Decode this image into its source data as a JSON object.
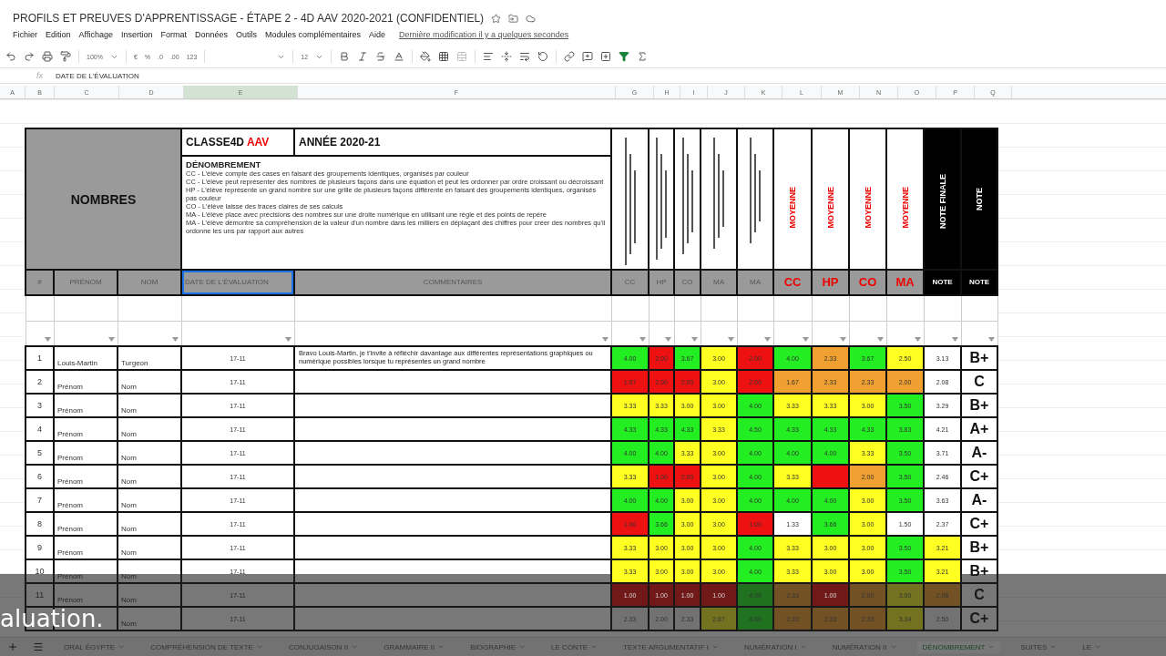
{
  "document": {
    "title": "PROFILS ET PREUVES D'APPRENTISSAGE - ÉTAPE 2 - 4D AAV 2020-2021 (CONFIDENTIEL)"
  },
  "menu": [
    "Fichier",
    "Edition",
    "Affichage",
    "Insertion",
    "Format",
    "Données",
    "Outils",
    "Modules complémentaires",
    "Aide"
  ],
  "last_edit": "Dernière modification il y a quelques secondes",
  "toolbar": {
    "zoom": "100%",
    "currency": "€",
    "percent": "%",
    "decimals_less": ".0",
    "decimals_more": ".00",
    "number_format": "123",
    "font_size": "12"
  },
  "formula_bar": {
    "function_label": "fx",
    "value": "DATE DE L'ÉVALUATION"
  },
  "columns": [
    {
      "label": "A",
      "selected": false
    },
    {
      "label": "B",
      "selected": false
    },
    {
      "label": "C",
      "selected": false
    },
    {
      "label": "D",
      "selected": false
    },
    {
      "label": "E",
      "selected": true
    },
    {
      "label": "F",
      "selected": false
    },
    {
      "label": "G",
      "selected": false
    },
    {
      "label": "H",
      "selected": false
    },
    {
      "label": "I",
      "selected": false
    },
    {
      "label": "J",
      "selected": false
    },
    {
      "label": "K",
      "selected": false
    },
    {
      "label": "L",
      "selected": false
    },
    {
      "label": "M",
      "selected": false
    },
    {
      "label": "N",
      "selected": false
    },
    {
      "label": "O",
      "selected": false
    },
    {
      "label": "P",
      "selected": false
    },
    {
      "label": "Q",
      "selected": false
    }
  ],
  "sheet": {
    "subject": "NOMBRES",
    "class_name": "CLASSE4D",
    "class_tag": "AAV",
    "year": "ANNÉE 2020-21",
    "description_title": "DÉNOMBREMENT",
    "description": [
      "CC - L'élève compte des cases en faisant des groupements identiques, organisés par couleur",
      "CC - L'élève peut représenter des nombres de plusieurs façons dans une équation et peut les ordonner par ordre croissant ou décroissant",
      "HP - L'élève représente un grand nombre sur une grille de plusieurs façons différente en faisant des groupements identiques, organisés pas couleur",
      "CO - L'élève laisse des traces claires de ses calculs",
      "MA - L'élève place avec précisions des nombres sur une droite numérique en utilisant une règle et des points de repère",
      "MA - L'élève démontre sa compréhension de la valeur d'un nombre dans les milliers en déplaçant des chiffres pour créer des nombres qu'il ordonne les uns par rapport aux autres"
    ],
    "criteria": [
      {
        "kind": "lines"
      },
      {
        "kind": "lines"
      },
      {
        "kind": "lines"
      },
      {
        "kind": "lines"
      },
      {
        "kind": "lines"
      }
    ],
    "averages": [
      "MOYENNE",
      "MOYENNE",
      "MOYENNE",
      "MOYENNE"
    ],
    "final_title": "NOTE FINALE",
    "note_title": "NOTE"
  },
  "headers": [
    {
      "label": "#",
      "kind": "plain",
      "selected": false
    },
    {
      "label": "PRÉNOM",
      "kind": "plain",
      "selected": false
    },
    {
      "label": "NOM",
      "kind": "plain",
      "selected": false
    },
    {
      "label": "DATE DE L'ÉVALUATION",
      "kind": "plain",
      "selected": true
    },
    {
      "label": "COMMENTAIRES",
      "kind": "plain",
      "selected": false
    },
    {
      "label": "CC",
      "kind": "plain",
      "selected": false
    },
    {
      "label": "HP",
      "kind": "plain",
      "selected": false
    },
    {
      "label": "CO",
      "kind": "plain",
      "selected": false
    },
    {
      "label": "MA",
      "kind": "plain",
      "selected": false
    },
    {
      "label": "MA",
      "kind": "plain",
      "selected": false
    },
    {
      "label": "CC",
      "kind": "average",
      "selected": false
    },
    {
      "label": "HP",
      "kind": "average",
      "selected": false
    },
    {
      "label": "CO",
      "kind": "average",
      "selected": false
    },
    {
      "label": "MA",
      "kind": "average",
      "selected": false
    },
    {
      "label": "NOTE",
      "kind": "final",
      "selected": false
    },
    {
      "label": "NOTE",
      "kind": "final",
      "selected": false
    }
  ],
  "rows": [
    {
      "number": "1",
      "first_name": "Louis-Martin",
      "last_name": "Turgeon",
      "date": "17-11",
      "comment": "Bravo Louis-Martin, je t'invite à réfléchir davantage aux différentes représentations graphiques ou numérique possibles lorsque tu représentes un grand nombre",
      "scores": [
        {
          "value": "4.00",
          "color": "#22ee22"
        },
        {
          "value": "2.00",
          "color": "#ee1111"
        },
        {
          "value": "3.67",
          "color": "#22ee22"
        },
        {
          "value": "3.00",
          "color": "#ffff22"
        },
        {
          "value": "2.00",
          "color": "#ee1111"
        },
        {
          "value": "4.00",
          "color": "#22ee22"
        },
        {
          "value": "2.33",
          "color": "#f0a030"
        },
        {
          "value": "3.67",
          "color": "#22ee22"
        },
        {
          "value": "2.50",
          "color": "#ffff22"
        }
      ],
      "final": {
        "value": "3.13",
        "color": "#ffffff"
      },
      "grade": "B+"
    },
    {
      "number": "2",
      "first_name": "Prénom",
      "last_name": "Nom",
      "date": "17-11",
      "scores": [
        {
          "value": "1.67",
          "color": "#ee1111"
        },
        {
          "value": "2.00",
          "color": "#ee1111"
        },
        {
          "value": "2.00",
          "color": "#ee1111"
        },
        {
          "value": "3.00",
          "color": "#ffff22"
        },
        {
          "value": "2.00",
          "color": "#ee1111"
        },
        {
          "value": "1.67",
          "color": "#f0a030"
        },
        {
          "value": "2.33",
          "color": "#f0a030"
        },
        {
          "value": "2.33",
          "color": "#f0a030"
        },
        {
          "value": "2.00",
          "color": "#f0a030"
        }
      ],
      "final": {
        "value": "2.08",
        "color": "#ffffff"
      },
      "grade": "C"
    },
    {
      "number": "3",
      "first_name": "Prénom",
      "last_name": "Nom",
      "date": "17-11",
      "scores": [
        {
          "value": "3.33",
          "color": "#ffff22"
        },
        {
          "value": "3.33",
          "color": "#ffff22"
        },
        {
          "value": "3.00",
          "color": "#ffff22"
        },
        {
          "value": "3.00",
          "color": "#ffff22"
        },
        {
          "value": "4.00",
          "color": "#22ee22"
        },
        {
          "value": "3.33",
          "color": "#ffff22"
        },
        {
          "value": "3.33",
          "color": "#ffff22"
        },
        {
          "value": "3.00",
          "color": "#ffff22"
        },
        {
          "value": "3.50",
          "color": "#22ee22"
        }
      ],
      "final": {
        "value": "3.29",
        "color": "#ffffff"
      },
      "grade": "B+"
    },
    {
      "number": "4",
      "first_name": "Prénom",
      "last_name": "Nom",
      "date": "17-11",
      "scores": [
        {
          "value": "4.33",
          "color": "#22ee22"
        },
        {
          "value": "4.33",
          "color": "#22ee22"
        },
        {
          "value": "4.33",
          "color": "#22ee22"
        },
        {
          "value": "3.33",
          "color": "#ffff22"
        },
        {
          "value": "4.50",
          "color": "#22ee22"
        },
        {
          "value": "4.33",
          "color": "#22ee22"
        },
        {
          "value": "4.33",
          "color": "#22ee22"
        },
        {
          "value": "4.33",
          "color": "#22ee22"
        },
        {
          "value": "3.83",
          "color": "#22ee22"
        }
      ],
      "final": {
        "value": "4.21",
        "color": "#ffffff"
      },
      "grade": "A+"
    },
    {
      "number": "5",
      "first_name": "Prénom",
      "last_name": "Nom",
      "date": "17-11",
      "scores": [
        {
          "value": "4.00",
          "color": "#22ee22"
        },
        {
          "value": "4.00",
          "color": "#22ee22"
        },
        {
          "value": "3.33",
          "color": "#ffff22"
        },
        {
          "value": "3.00",
          "color": "#ffff22"
        },
        {
          "value": "4.00",
          "color": "#22ee22"
        },
        {
          "value": "4.00",
          "color": "#22ee22"
        },
        {
          "value": "4.00",
          "color": "#22ee22"
        },
        {
          "value": "3.33",
          "color": "#ffff22"
        },
        {
          "value": "3.50",
          "color": "#22ee22"
        }
      ],
      "final": {
        "value": "3.71",
        "color": "#ffffff"
      },
      "grade": "A-"
    },
    {
      "number": "6",
      "first_name": "Prénom",
      "last_name": "Nom",
      "date": "17-11",
      "scores": [
        {
          "value": "3.33",
          "color": "#ffff22"
        },
        {
          "value": "1.00",
          "color": "#ee1111"
        },
        {
          "value": "2.00",
          "color": "#ee1111"
        },
        {
          "value": "3.00",
          "color": "#ffff22"
        },
        {
          "value": "4.00",
          "color": "#22ee22"
        },
        {
          "value": "3.33",
          "color": "#ffff22"
        },
        {
          "color": "#ee1111"
        },
        {
          "value": "2.00",
          "color": "#f0a030"
        },
        {
          "value": "3.50",
          "color": "#22ee22"
        }
      ],
      "final": {
        "value": "2.46",
        "color": "#ffffff"
      },
      "grade": "C+"
    },
    {
      "number": "7",
      "first_name": "Prénom",
      "last_name": "Nom",
      "date": "17-11",
      "scores": [
        {
          "value": "4.00",
          "color": "#22ee22"
        },
        {
          "value": "4.00",
          "color": "#22ee22"
        },
        {
          "value": "3.00",
          "color": "#ffff22"
        },
        {
          "value": "3.00",
          "color": "#ffff22"
        },
        {
          "value": "4.00",
          "color": "#22ee22"
        },
        {
          "value": "4.00",
          "color": "#22ee22"
        },
        {
          "value": "4.00",
          "color": "#22ee22"
        },
        {
          "value": "3.00",
          "color": "#ffff22"
        },
        {
          "value": "3.50",
          "color": "#22ee22"
        }
      ],
      "final": {
        "value": "3.63",
        "color": "#ffffff"
      },
      "grade": "A-"
    },
    {
      "number": "8",
      "first_name": "Prénom",
      "last_name": "Nom",
      "date": "17-11",
      "scores": [
        {
          "value": "1.00",
          "color": "#ee1111"
        },
        {
          "value": "3.66",
          "color": "#22ee22"
        },
        {
          "value": "3.00",
          "color": "#ffff22"
        },
        {
          "value": "3.00",
          "color": "#ffff22"
        },
        {
          "value": "1.00",
          "color": "#ee1111"
        },
        {
          "value": "1.33",
          "color": "#ffffff"
        },
        {
          "value": "3.66",
          "color": "#22ee22"
        },
        {
          "value": "3.00",
          "color": "#ffff22"
        },
        {
          "value": "1.50",
          "color": "#ffffff"
        }
      ],
      "final": {
        "value": "2.37",
        "color": "#ffffff"
      },
      "grade": "C+"
    },
    {
      "number": "9",
      "first_name": "Prénom",
      "last_name": "Nom",
      "date": "17-11",
      "scores": [
        {
          "value": "3.33",
          "color": "#ffff22"
        },
        {
          "value": "3.00",
          "color": "#ffff22"
        },
        {
          "value": "3.00",
          "color": "#ffff22"
        },
        {
          "value": "3.00",
          "color": "#ffff22"
        },
        {
          "value": "4.00",
          "color": "#22ee22"
        },
        {
          "value": "3.33",
          "color": "#ffff22"
        },
        {
          "value": "3.00",
          "color": "#ffff22"
        },
        {
          "value": "3.00",
          "color": "#ffff22"
        },
        {
          "value": "3.50",
          "color": "#22ee22"
        }
      ],
      "final": {
        "value": "3.21",
        "color": "#ffff22"
      },
      "grade": "B+"
    },
    {
      "number": "10",
      "first_name": "Prénom",
      "last_name": "Nom",
      "date": "17-11",
      "scores": [
        {
          "value": "3.33",
          "color": "#ffff22"
        },
        {
          "value": "3.00",
          "color": "#ffff22"
        },
        {
          "value": "3.00",
          "color": "#ffff22"
        },
        {
          "value": "3.00",
          "color": "#ffff22"
        },
        {
          "value": "4.00",
          "color": "#22ee22"
        },
        {
          "value": "3.33",
          "color": "#ffff22"
        },
        {
          "value": "3.00",
          "color": "#ffff22"
        },
        {
          "value": "3.00",
          "color": "#ffff22"
        },
        {
          "value": "3.50",
          "color": "#22ee22"
        }
      ],
      "final": {
        "value": "3.21",
        "color": "#ffff22"
      },
      "grade": "B+"
    },
    {
      "number": "11",
      "first_name": "Prénom",
      "last_name": "Nom",
      "date": "17-11",
      "scores": [
        {
          "value": "1.00",
          "color": "#711818"
        },
        {
          "value": "1.00",
          "color": "#711818"
        },
        {
          "value": "1.00",
          "color": "#711818"
        },
        {
          "value": "1.00",
          "color": "#711818"
        },
        {
          "value": "4.00",
          "color": "#207120"
        },
        {
          "value": "2.33",
          "color": "#725225"
        },
        {
          "value": "1.00",
          "color": "#711818"
        },
        {
          "value": "2.00",
          "color": "#725225"
        },
        {
          "value": "3.00",
          "color": "#727220"
        }
      ],
      "final": {
        "value": "2.08",
        "color": "#725225"
      },
      "grade": "C"
    },
    {
      "last_name": "Nom",
      "date": "17-11",
      "scores": [
        {
          "value": "2.33",
          "color": "#727272"
        },
        {
          "value": "2.00",
          "color": "#727272"
        },
        {
          "value": "2.33",
          "color": "#727272"
        },
        {
          "value": "2.67",
          "color": "#727220"
        },
        {
          "value": "4.00",
          "color": "#207120"
        },
        {
          "value": "2.33",
          "color": "#725225"
        },
        {
          "value": "2.33",
          "color": "#725225"
        },
        {
          "value": "2.33",
          "color": "#725225"
        },
        {
          "value": "3.34",
          "color": "#727220"
        }
      ],
      "final": {
        "value": "2.50",
        "color": "#727272"
      },
      "grade": "C+"
    }
  ],
  "sheet_tabs": [
    {
      "label": "ORAL ÉGYPTE",
      "selected": false
    },
    {
      "label": "COMPRÉHENSION DE TEXTE",
      "selected": false
    },
    {
      "label": "CONJUGAISON II",
      "selected": false
    },
    {
      "label": "GRAMMAIRE II",
      "selected": false
    },
    {
      "label": "BIOGRAPHIE",
      "selected": false
    },
    {
      "label": "LE CONTE",
      "selected": false
    },
    {
      "label": "TEXTE ARGUMENTATIF I",
      "selected": false
    },
    {
      "label": "NUMÉRATION I",
      "selected": false
    },
    {
      "label": "NUMÉRATION II",
      "selected": false
    },
    {
      "label": "DÉNOMBREMENT",
      "selected": true
    },
    {
      "label": "SUITES",
      "selected": false
    },
    {
      "label": "LE",
      "selected": false
    }
  ],
  "caption": "aluation."
}
